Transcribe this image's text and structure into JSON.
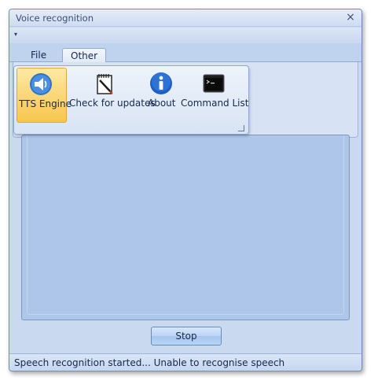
{
  "window": {
    "title": "Voice recognition",
    "close_glyph": "×"
  },
  "quick_access": {
    "dropdown_glyph": "▾"
  },
  "tabs": [
    {
      "label": "File",
      "active": false
    },
    {
      "label": "Other",
      "active": true
    }
  ],
  "ribbon": {
    "buttons": [
      {
        "label": "TTS Engine",
        "icon": "speaker-icon",
        "selected": true
      },
      {
        "label": "Check for updates",
        "icon": "notepad-pencil-icon",
        "selected": false
      },
      {
        "label": "About",
        "icon": "info-icon",
        "selected": false
      },
      {
        "label": "Command List",
        "icon": "terminal-icon",
        "selected": false
      }
    ]
  },
  "actions": {
    "stop_label": "Stop"
  },
  "status": {
    "text": "Speech recognition started...  Unable to recognise speech"
  },
  "colors": {
    "accent": "#adc6ea",
    "selected_button": "#f8c64d",
    "info_blue": "#1d5fc4"
  }
}
